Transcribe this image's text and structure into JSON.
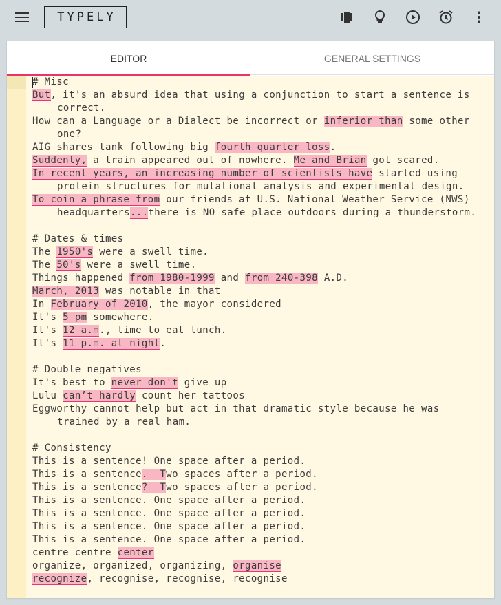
{
  "app": {
    "logo": "TYPELY",
    "icons": [
      "menu-icon",
      "book-icon",
      "lightbulb-icon",
      "play-circle-icon",
      "alarm-icon",
      "more-vert-icon"
    ]
  },
  "tabs": [
    {
      "label": "EDITOR",
      "active": true
    },
    {
      "label": "GENERAL SETTINGS",
      "active": false
    }
  ],
  "colors": {
    "accent": "#e8346b",
    "highlight": "#f8b7c3",
    "editor_bg": "#fff8e2",
    "gutter_bg": "#fdf0c4",
    "page_bg": "#d3dbdf"
  },
  "editor": {
    "lines": [
      {
        "segs": [
          {
            "t": "# Misc"
          }
        ]
      },
      {
        "segs": [
          {
            "t": "But",
            "h": true
          },
          {
            "t": ", it's an absurd idea that using a conjunction to start a sentence is"
          }
        ]
      },
      {
        "cont": true,
        "segs": [
          {
            "t": "correct."
          }
        ]
      },
      {
        "segs": [
          {
            "t": "How can a Language or a Dialect be incorrect or "
          },
          {
            "t": "inferior than",
            "h": true
          },
          {
            "t": " some other"
          }
        ]
      },
      {
        "cont": true,
        "segs": [
          {
            "t": "one?"
          }
        ]
      },
      {
        "segs": [
          {
            "t": "AIG shares tank following big "
          },
          {
            "t": "fourth quarter loss",
            "h": true
          },
          {
            "t": "."
          }
        ]
      },
      {
        "segs": [
          {
            "t": "Suddenly,",
            "h": true
          },
          {
            "t": " a train appeared out of nowhere. "
          },
          {
            "t": "Me and Brian",
            "h": true
          },
          {
            "t": " got scared."
          }
        ]
      },
      {
        "segs": [
          {
            "t": "In recent years, an increasing number of scientists have",
            "h": true
          },
          {
            "t": " started using"
          }
        ]
      },
      {
        "cont": true,
        "segs": [
          {
            "t": "protein structures for mutational analysis and experimental design."
          }
        ]
      },
      {
        "segs": [
          {
            "t": "To coin a phrase from",
            "h": true
          },
          {
            "t": " our friends at U.S. National Weather Service (NWS)"
          }
        ]
      },
      {
        "cont": true,
        "segs": [
          {
            "t": "headquarters"
          },
          {
            "t": "...",
            "h": true
          },
          {
            "t": "there is NO safe place outdoors during a thunderstorm."
          }
        ]
      },
      {
        "blank": true,
        "segs": []
      },
      {
        "segs": [
          {
            "t": "# Dates & times"
          }
        ]
      },
      {
        "segs": [
          {
            "t": "The "
          },
          {
            "t": "1950's",
            "h": true
          },
          {
            "t": " were a swell time."
          }
        ]
      },
      {
        "segs": [
          {
            "t": "The "
          },
          {
            "t": "50's",
            "h": true
          },
          {
            "t": " were a swell time."
          }
        ]
      },
      {
        "segs": [
          {
            "t": "Things happened "
          },
          {
            "t": "from 1980-1999",
            "h": true
          },
          {
            "t": " and "
          },
          {
            "t": "from 240-398",
            "h": true
          },
          {
            "t": " A.D."
          }
        ]
      },
      {
        "segs": [
          {
            "t": "March, 2013",
            "h": true
          },
          {
            "t": " was notable in that"
          }
        ]
      },
      {
        "segs": [
          {
            "t": "In "
          },
          {
            "t": "February of 2010",
            "h": true
          },
          {
            "t": ", the mayor considered"
          }
        ]
      },
      {
        "segs": [
          {
            "t": "It's "
          },
          {
            "t": "5 pm",
            "h": true
          },
          {
            "t": " somewhere."
          }
        ]
      },
      {
        "segs": [
          {
            "t": "It's "
          },
          {
            "t": "12 a.m",
            "h": true
          },
          {
            "t": "., time to eat lunch."
          }
        ]
      },
      {
        "segs": [
          {
            "t": "It's "
          },
          {
            "t": "11 p.m. at night",
            "h": true
          },
          {
            "t": "."
          }
        ]
      },
      {
        "blank": true,
        "segs": []
      },
      {
        "segs": [
          {
            "t": "# Double negatives"
          }
        ]
      },
      {
        "segs": [
          {
            "t": "It's best to "
          },
          {
            "t": "never don't",
            "h": true
          },
          {
            "t": " give up"
          }
        ]
      },
      {
        "segs": [
          {
            "t": "Lulu "
          },
          {
            "t": "can’t hardly",
            "h": true
          },
          {
            "t": " count her tattoos"
          }
        ]
      },
      {
        "segs": [
          {
            "t": "Eggworthy cannot help but act in that dramatic style because he was"
          }
        ]
      },
      {
        "cont": true,
        "segs": [
          {
            "t": "trained by a real ham."
          }
        ]
      },
      {
        "blank": true,
        "segs": []
      },
      {
        "segs": [
          {
            "t": "# Consistency"
          }
        ]
      },
      {
        "segs": [
          {
            "t": "This is a sentence! One space after a period."
          }
        ]
      },
      {
        "segs": [
          {
            "t": "This is a sentence"
          },
          {
            "t": ".  T",
            "h": true
          },
          {
            "t": "wo spaces after a period."
          }
        ]
      },
      {
        "segs": [
          {
            "t": "This is a sentence"
          },
          {
            "t": "?  T",
            "h": true
          },
          {
            "t": "wo spaces after a period."
          }
        ]
      },
      {
        "segs": [
          {
            "t": "This is a sentence. One space after a period."
          }
        ]
      },
      {
        "segs": [
          {
            "t": "This is a sentence. One space after a period."
          }
        ]
      },
      {
        "segs": [
          {
            "t": "This is a sentence. One space after a period."
          }
        ]
      },
      {
        "segs": [
          {
            "t": "This is a sentence. One space after a period."
          }
        ]
      },
      {
        "segs": [
          {
            "t": "centre centre "
          },
          {
            "t": "center",
            "h": true
          }
        ]
      },
      {
        "segs": [
          {
            "t": "organize, organized, organizing, "
          },
          {
            "t": "organise",
            "h": true
          }
        ]
      },
      {
        "segs": [
          {
            "t": "recognize",
            "h": true
          },
          {
            "t": ", recognise, recognise, recognise"
          }
        ]
      }
    ]
  }
}
